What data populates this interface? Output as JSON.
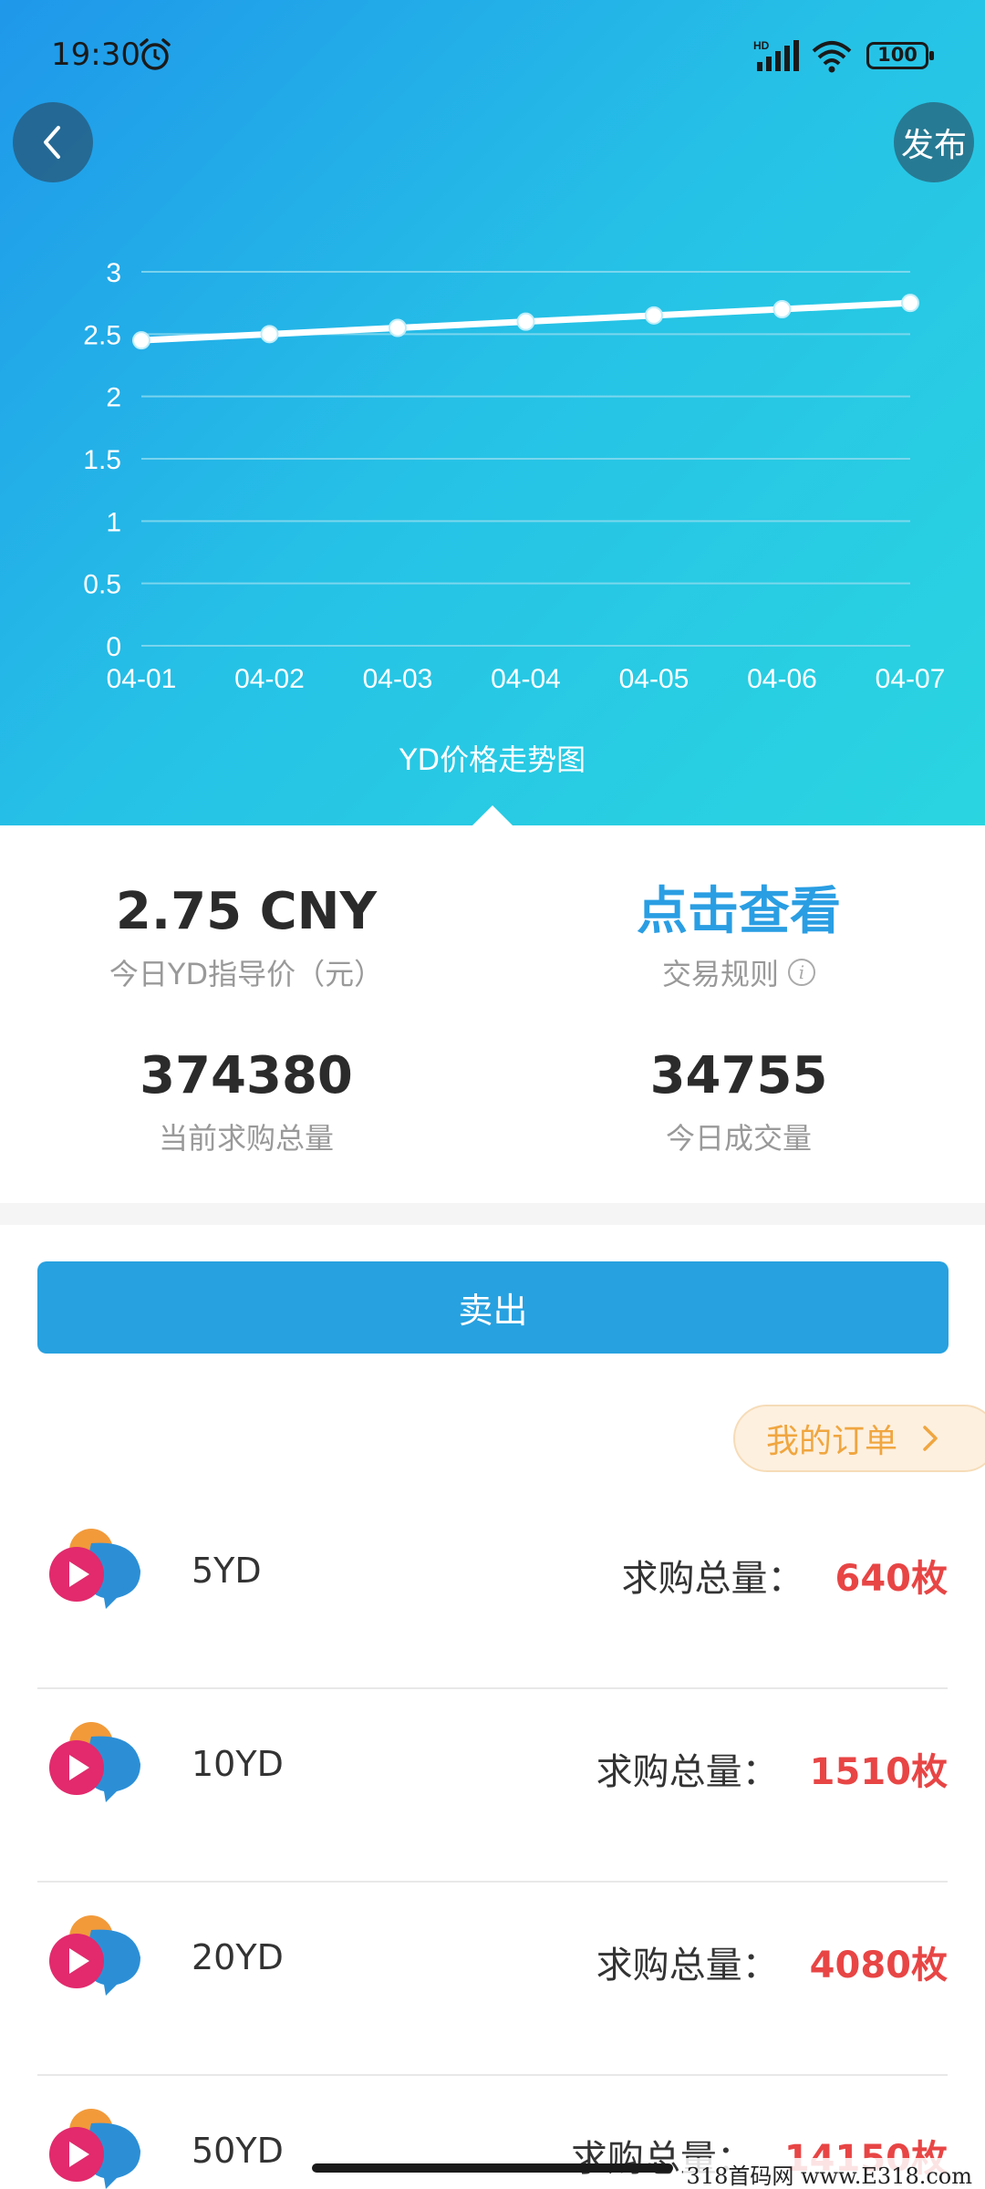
{
  "status_bar": {
    "time": "19:30",
    "battery": "100",
    "network": "HD"
  },
  "header": {
    "publish_label": "发布"
  },
  "chart_data": {
    "type": "line",
    "categories": [
      "04-01",
      "04-02",
      "04-03",
      "04-04",
      "04-05",
      "04-06",
      "04-07"
    ],
    "series": [
      {
        "values": [
          2.45,
          2.5,
          2.55,
          2.6,
          2.65,
          2.7,
          2.75
        ]
      }
    ],
    "ylim": [
      0,
      3
    ],
    "yticks": [
      "0",
      "0.5",
      "1",
      "1.5",
      "2",
      "2.5",
      "3"
    ],
    "grid": true,
    "title": "YD价格走势图",
    "colors": {
      "line": "#ffffff",
      "grid": "#8fdcf0"
    }
  },
  "stats": {
    "price_value": "2.75 CNY",
    "price_label": "今日YD指导价（元）",
    "rules_value": "点击查看",
    "rules_label": "交易规则",
    "demand_value": "374380",
    "demand_label": "当前求购总量",
    "volume_value": "34755",
    "volume_label": "今日成交量"
  },
  "actions": {
    "sell_label": "卖出",
    "my_orders_label": "我的订单"
  },
  "items": [
    {
      "name": "5YD",
      "demand_label": "求购总量：",
      "demand_value": "640枚"
    },
    {
      "name": "10YD",
      "demand_label": "求购总量：",
      "demand_value": "1510枚"
    },
    {
      "name": "20YD",
      "demand_label": "求购总量：",
      "demand_value": "4080枚"
    },
    {
      "name": "50YD",
      "demand_label": "求购总量：",
      "demand_value": "14150枚"
    }
  ],
  "watermark": "318首码网 www.E318.com",
  "colors": {
    "accent": "#27a1e0",
    "demand": "#e84545",
    "orders": "#f0a640"
  }
}
